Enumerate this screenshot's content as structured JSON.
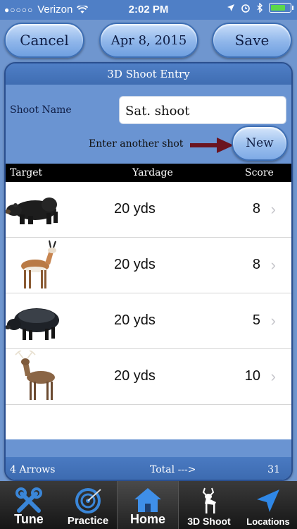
{
  "status_bar": {
    "carrier": "Verizon",
    "time": "2:02 PM",
    "signal_dots": "●○○○○"
  },
  "toolbar": {
    "cancel_label": "Cancel",
    "date_label": "Apr 8, 2015",
    "save_label": "Save"
  },
  "entry": {
    "title": "3D Shoot Entry",
    "shoot_name_label": "Shoot Name",
    "shoot_name_value": "Sat. shoot",
    "another_shot_label": "Enter another shot",
    "new_label": "New"
  },
  "columns": {
    "target": "Target",
    "yardage": "Yardage",
    "score": "Score"
  },
  "shots": [
    {
      "target_icon": "bear-target-icon",
      "yardage": "20 yds",
      "score": "8"
    },
    {
      "target_icon": "antelope-target-icon",
      "yardage": "20 yds",
      "score": "8"
    },
    {
      "target_icon": "boar-target-icon",
      "yardage": "20 yds",
      "score": "5"
    },
    {
      "target_icon": "deer-target-icon",
      "yardage": "20 yds",
      "score": "10"
    }
  ],
  "footer": {
    "arrows": "4 Arrows",
    "total_label": "Total --->",
    "total_value": "31"
  },
  "tabs": [
    {
      "label": "Tune",
      "icon": "tools-icon"
    },
    {
      "label": "Practice",
      "icon": "target-icon"
    },
    {
      "label": "Home",
      "icon": "home-icon"
    },
    {
      "label": "3D Shoot",
      "icon": "deer-icon"
    },
    {
      "label": "Locations",
      "icon": "location-arrow-icon"
    }
  ],
  "colors": {
    "background": "#6f96cf",
    "panel_header": "#4f7fc6",
    "button_border": "#3e6fb4",
    "arrow": "#6b1420",
    "home_icon": "#3f8fe8"
  }
}
